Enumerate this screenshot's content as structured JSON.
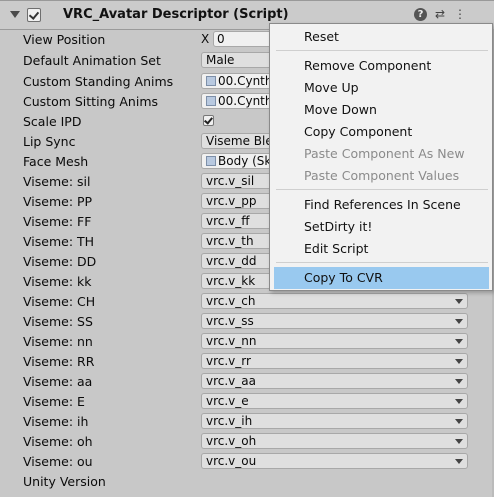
{
  "header": {
    "title": "VRC_Avatar Descriptor (Script)",
    "help_icon": "?",
    "preset_icon": "⇄",
    "more_icon": "⋮"
  },
  "rows": {
    "view_position": {
      "label": "View Position",
      "axis": "X",
      "value": "0"
    },
    "animation_set": {
      "label": "Default Animation Set",
      "value": "Male"
    },
    "standing_anims": {
      "label": "Custom Standing Anims",
      "value": "00.Cynth"
    },
    "sitting_anims": {
      "label": "Custom Sitting Anims",
      "value": "00.Cynth"
    },
    "scale_ipd": {
      "label": "Scale IPD",
      "checked": true
    },
    "lip_sync": {
      "label": "Lip Sync",
      "value": "Viseme Ble"
    },
    "face_mesh": {
      "label": "Face Mesh",
      "value": "Body (Sk"
    },
    "unity_version": {
      "label": "Unity Version"
    }
  },
  "visemes": [
    {
      "label": "Viseme: sil",
      "value": "vrc.v_sil"
    },
    {
      "label": "Viseme: PP",
      "value": "vrc.v_pp"
    },
    {
      "label": "Viseme: FF",
      "value": "vrc.v_ff"
    },
    {
      "label": "Viseme: TH",
      "value": "vrc.v_th"
    },
    {
      "label": "Viseme: DD",
      "value": "vrc.v_dd"
    },
    {
      "label": "Viseme: kk",
      "value": "vrc.v_kk"
    },
    {
      "label": "Viseme: CH",
      "value": "vrc.v_ch"
    },
    {
      "label": "Viseme: SS",
      "value": "vrc.v_ss"
    },
    {
      "label": "Viseme: nn",
      "value": "vrc.v_nn"
    },
    {
      "label": "Viseme: RR",
      "value": "vrc.v_rr"
    },
    {
      "label": "Viseme: aa",
      "value": "vrc.v_aa"
    },
    {
      "label": "Viseme: E",
      "value": "vrc.v_e"
    },
    {
      "label": "Viseme: ih",
      "value": "vrc.v_ih"
    },
    {
      "label": "Viseme: oh",
      "value": "vrc.v_oh"
    },
    {
      "label": "Viseme: ou",
      "value": "vrc.v_ou"
    }
  ],
  "context_menu": {
    "items": [
      {
        "label": "Reset",
        "enabled": true
      },
      {
        "label": "Remove Component",
        "enabled": true
      },
      {
        "label": "Move Up",
        "enabled": true
      },
      {
        "label": "Move Down",
        "enabled": true
      },
      {
        "label": "Copy Component",
        "enabled": true
      },
      {
        "label": "Paste Component As New",
        "enabled": false
      },
      {
        "label": "Paste Component Values",
        "enabled": false
      },
      {
        "label": "Find References In Scene",
        "enabled": true
      },
      {
        "label": "SetDirty it!",
        "enabled": true
      },
      {
        "label": "Edit Script",
        "enabled": true
      },
      {
        "label": "Copy To CVR",
        "enabled": true,
        "highlighted": true
      }
    ]
  },
  "colors": {
    "menu_highlight": "#99c9ef",
    "background": "#c8c8c8"
  }
}
